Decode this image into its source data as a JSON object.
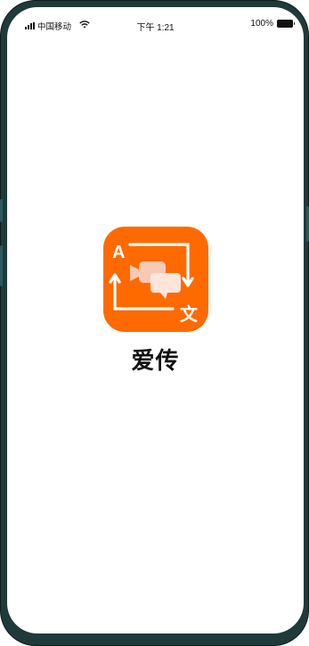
{
  "status_bar": {
    "carrier": "中国移动",
    "time": "下午 1:21",
    "battery": "100%",
    "signal_icon": "cellular-signal-icon",
    "wifi_icon": "wifi-icon",
    "battery_icon": "battery-icon"
  },
  "app": {
    "name": "爱传",
    "icon_letter_a": "A",
    "icon_letter_wen": "文",
    "icon_name": "translate-video-chat-icon"
  },
  "colors": {
    "accent": "#ff6a00",
    "phone_frame": "#1f3a3a"
  }
}
